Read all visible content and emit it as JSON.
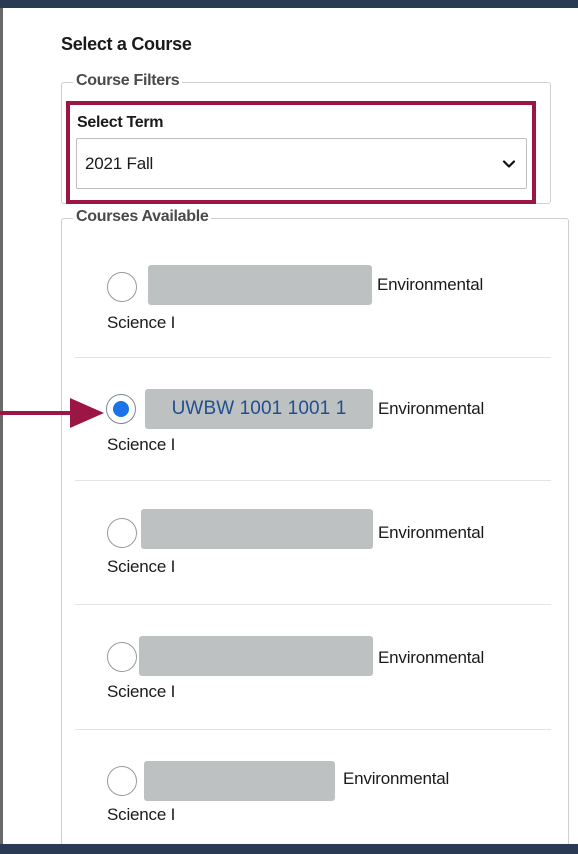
{
  "page": {
    "title": "Select a Course",
    "filters_legend": "Course Filters",
    "term_label": "Select Term",
    "term_value": "2021 Fall",
    "courses_legend": "Courses Available"
  },
  "courses": [
    {
      "code": "",
      "name_line1": "Environmental",
      "name_line2": "Science I",
      "selected": false
    },
    {
      "code": "UWBW 1001 1001 1",
      "name_line1": "Environmental",
      "name_line2": "Science I",
      "selected": true
    },
    {
      "code": "",
      "name_line1": "Environmental",
      "name_line2": "Science I",
      "selected": false
    },
    {
      "code": "",
      "name_line1": "Environmental",
      "name_line2": "Science I",
      "selected": false
    },
    {
      "code": "",
      "name_line1": "Environmental",
      "name_line2": "Science I",
      "selected": false
    }
  ],
  "colors": {
    "header_bar": "#2a3a55",
    "highlight_border": "#9b1545",
    "arrow": "#9b1545",
    "redaction": "#bdc1c2",
    "radio_selected": "#1a73e8",
    "code_text": "#1f4f8e"
  },
  "icons": {
    "select_caret": "chevron-down-icon",
    "callout": "arrow-right-icon"
  }
}
